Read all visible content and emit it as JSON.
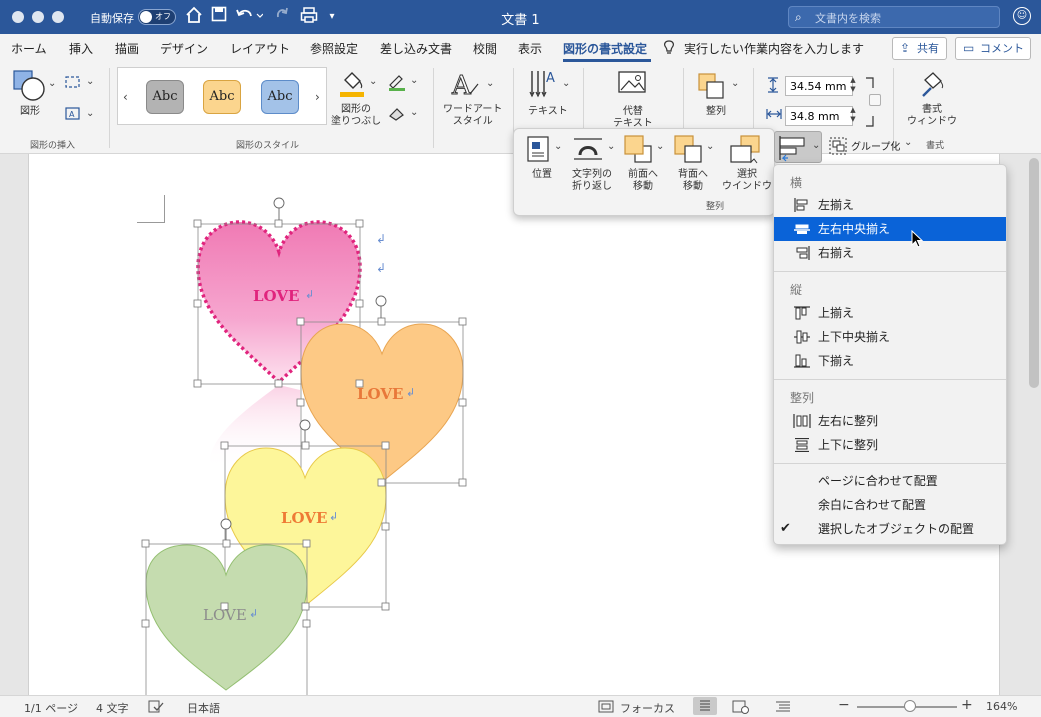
{
  "titlebar": {
    "autosave_label": "自動保存",
    "toggle_state": "オフ",
    "document_title": "文書 1",
    "search_placeholder": "文書内を検索"
  },
  "tabs": [
    {
      "label": "ホーム"
    },
    {
      "label": "挿入"
    },
    {
      "label": "描画"
    },
    {
      "label": "デザイン"
    },
    {
      "label": "レイアウト"
    },
    {
      "label": "参照設定"
    },
    {
      "label": "差し込み文書"
    },
    {
      "label": "校閲"
    },
    {
      "label": "表示"
    },
    {
      "label": "図形の書式設定",
      "active": true
    }
  ],
  "tell_me": "実行したい作業内容を入力します",
  "share_label": "共有",
  "comment_label": "コメント",
  "ribbon": {
    "insert_shapes": {
      "shape_label": "図形",
      "group_label": "図形の挿入"
    },
    "shape_styles": {
      "swatch_text": "Abc",
      "fill_label": "図形の\n塗りつぶし",
      "group_label": "図形のスタイル",
      "swatch_colors": [
        "#b3b3b3",
        "#fbd58e",
        "#a3c2e8"
      ]
    },
    "wordart_label": "ワードアート\nスタイル",
    "text_label": "テキスト",
    "alt_text_label": "代替\nテキスト",
    "arrange_label": "整列",
    "height_value": "34.54 mm",
    "width_value": "34.8 mm",
    "format_pane_label": "書式\nウィンドウ",
    "format_group_label": "書式"
  },
  "arrange_panel": {
    "position_label": "位置",
    "wrap_label": "文字列の\n折り返し",
    "forward_label": "前面へ\n移動",
    "backward_label": "背面へ\n移動",
    "selection_pane_label": "選択\nウインドウ",
    "group_label": "グループ化",
    "panel_caption": "整列"
  },
  "align_menu": {
    "horizontal_header": "横",
    "horizontal_items": [
      "左揃え",
      "左右中央揃え",
      "右揃え"
    ],
    "selected_item": "左右中央揃え",
    "vertical_header": "縦",
    "vertical_items": [
      "上揃え",
      "上下中央揃え",
      "下揃え"
    ],
    "distribute_header": "整列",
    "distribute_items": [
      "左右に整列",
      "上下に整列"
    ],
    "relative_items": [
      "ページに合わせて配置",
      "余白に合わせて配置",
      "選択したオブジェクトの配置"
    ],
    "checked_item": "選択したオブジェクトの配置"
  },
  "document": {
    "heart_text": "LOVE",
    "heart_colors": [
      "#f07ab4",
      "#fdc985",
      "#fdf59a",
      "#c5dcaf"
    ]
  },
  "statusbar": {
    "page_info": "1/1 ページ",
    "word_count": "4 文字",
    "language": "日本語",
    "focus_label": "フォーカス",
    "zoom_level": "164%"
  }
}
